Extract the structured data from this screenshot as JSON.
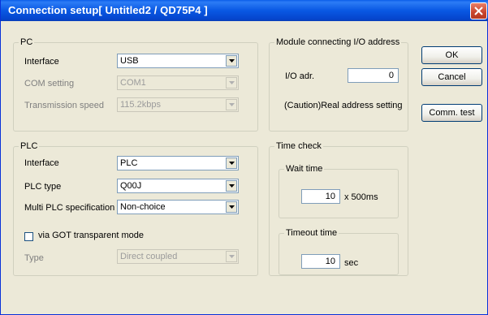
{
  "window": {
    "title": "Connection setup[ Untitled2 / QD75P4 ]"
  },
  "pc": {
    "group_label": "PC",
    "interface_label": "Interface",
    "interface_value": "USB",
    "com_label": "COM setting",
    "com_value": "COM1",
    "speed_label": "Transmission speed",
    "speed_value": "115.2kbps"
  },
  "module": {
    "group_label": "Module connecting I/O address",
    "io_label": "I/O adr.",
    "io_value": "0",
    "caution": "(Caution)Real address setting"
  },
  "buttons": {
    "ok": "OK",
    "cancel": "Cancel",
    "comm_test": "Comm. test"
  },
  "plc": {
    "group_label": "PLC",
    "interface_label": "Interface",
    "interface_value": "PLC",
    "type_label": "PLC type",
    "type_value": "Q00J",
    "multi_label": "Multi PLC specification",
    "multi_value": "Non-choice",
    "got_label": "via GOT transparent mode",
    "got_checked": false,
    "type2_label": "Type",
    "type2_value": "Direct coupled"
  },
  "time_check": {
    "group_label": "Time check",
    "wait_group_label": "Wait time",
    "wait_value": "10",
    "wait_unit": "x 500ms",
    "timeout_group_label": "Timeout time",
    "timeout_value": "10",
    "timeout_unit": "sec"
  },
  "colors": {
    "titlebar": "#0a5ee8",
    "dialog_bg": "#ece9d8",
    "close_button": "#c8442c"
  }
}
